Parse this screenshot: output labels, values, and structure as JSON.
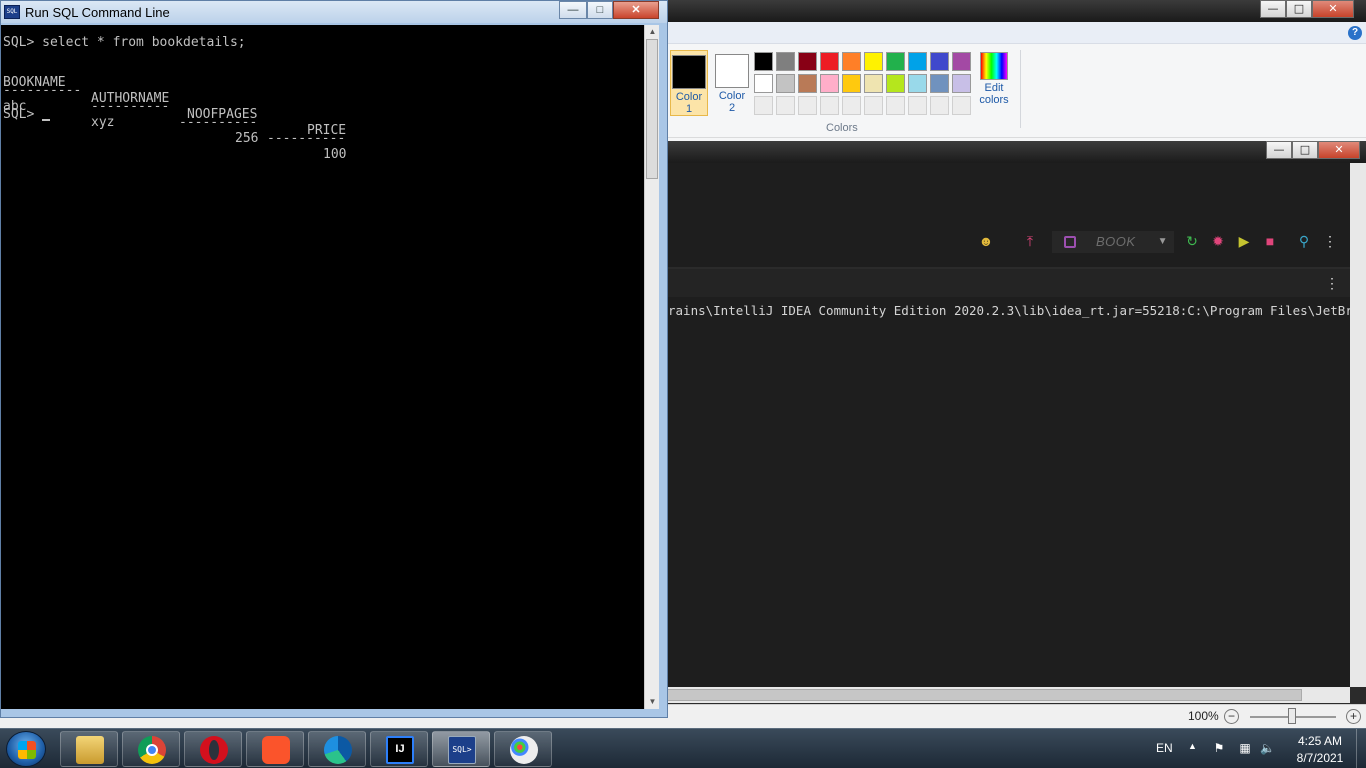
{
  "sql_window": {
    "title": "Run SQL Command Line",
    "controls": {
      "minimize": "—",
      "maximize": "□",
      "close": "✕"
    },
    "console": {
      "command_line": "SQL> select * from bookdetails;",
      "columns": [
        "BOOKNAME",
        "AUTHORNAME",
        "NOOFPAGES",
        "PRICE"
      ],
      "separators": [
        "----------",
        "----------",
        "----------",
        "----------"
      ],
      "rows": [
        [
          "abc",
          "xyz",
          "256",
          "100"
        ]
      ],
      "prompt": "SQL> "
    }
  },
  "paint": {
    "controls": {
      "minimize": "—",
      "maximize": "□",
      "close": "✕"
    },
    "help": "?",
    "color1_label_top": "Color",
    "color1_label_bottom": "1",
    "color2_label_top": "Color",
    "color2_label_bottom": "2",
    "color1_value": "#000000",
    "color2_value": "#ffffff",
    "edit_colors_top": "Edit",
    "edit_colors_bottom": "colors",
    "colors_group_label": "Colors",
    "palette_row1": [
      "#000000",
      "#7f7f7f",
      "#880015",
      "#ed1c24",
      "#ff7f27",
      "#fff200",
      "#22b14c",
      "#00a2e8",
      "#3f48cc",
      "#a349a4"
    ],
    "palette_row2": [
      "#ffffff",
      "#c3c3c3",
      "#b97a57",
      "#ffaec9",
      "#ffc90e",
      "#efe4b0",
      "#b5e61d",
      "#99d9ea",
      "#7092be",
      "#c8bfe7"
    ],
    "status": {
      "zoom": "100%",
      "zoom_out": "−",
      "zoom_in": "+"
    }
  },
  "intellij": {
    "controls": {
      "minimize": "—",
      "maximize": "□",
      "close": "✕"
    },
    "run_config": "BOOK",
    "toolbar_icons": [
      "users-icon",
      "build-hammer-icon",
      "rerun-icon",
      "debug-icon",
      "coverage-icon",
      "stop-icon",
      "search-icon",
      "more-icon"
    ],
    "console_line": "rains\\IntelliJ IDEA Community Edition 2020.2.3\\lib\\idea_rt.jar=55218:C:\\Program Files\\JetBrains\\I"
  },
  "taskbar": {
    "apps": [
      "Windows Explorer",
      "Google Chrome",
      "Opera",
      "Brave",
      "Microsoft Edge",
      "IntelliJ IDEA",
      "Run SQL Command Line",
      "Paint"
    ],
    "idea_glyph": "IJ",
    "sql_glyph": "SQL>",
    "language": "EN",
    "time": "4:25 AM",
    "date": "8/7/2021"
  }
}
